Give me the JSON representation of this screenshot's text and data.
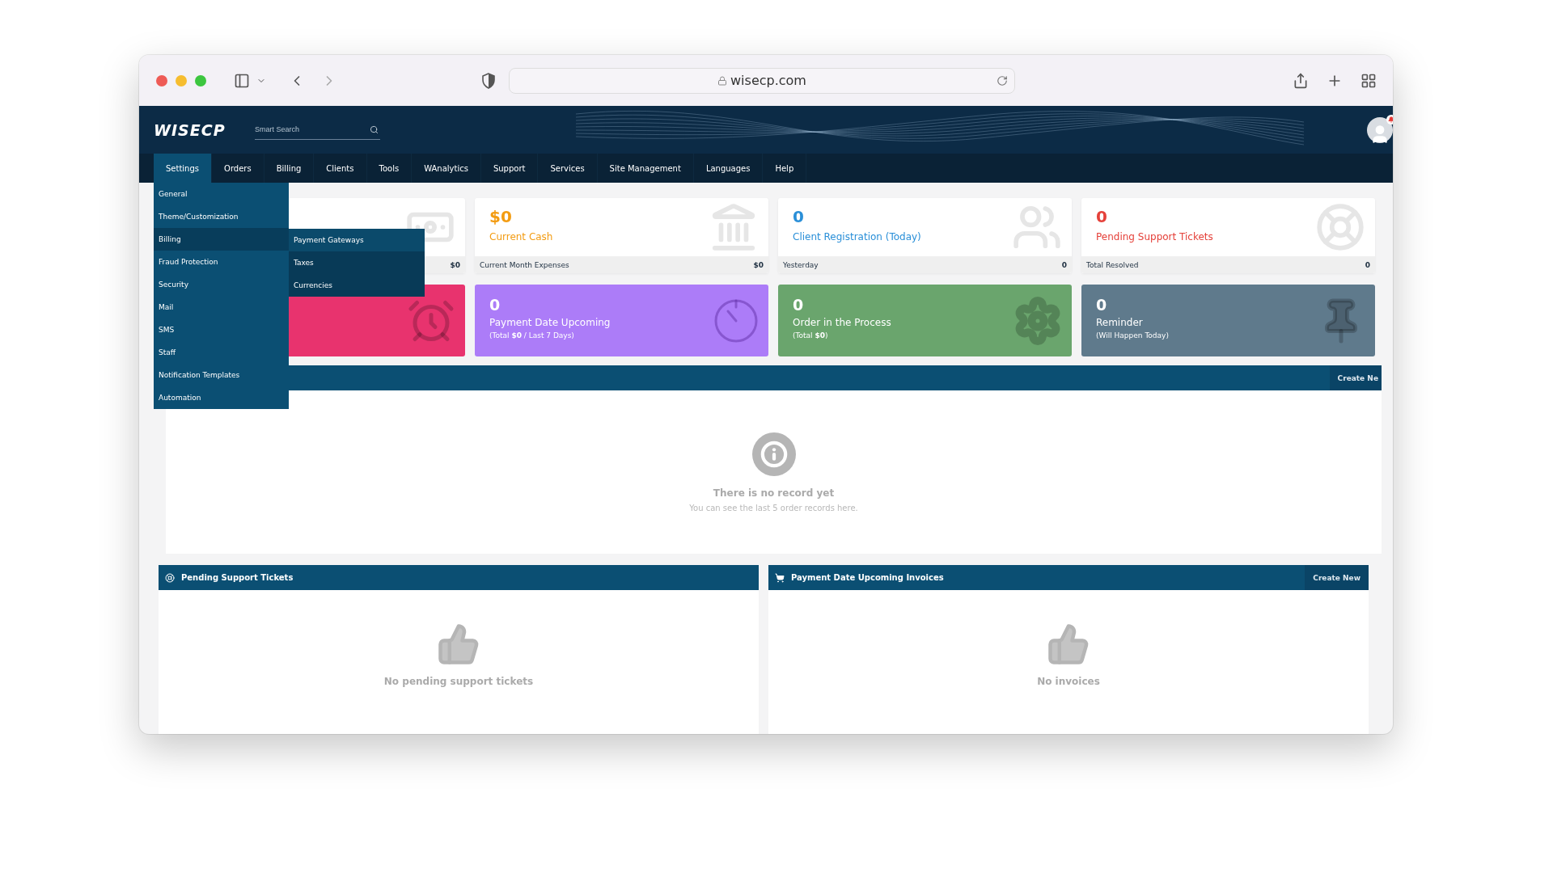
{
  "browser": {
    "url": "wisecp.com"
  },
  "header": {
    "logo": "WISECP",
    "search": {
      "placeholder": "Smart Search"
    },
    "notification": true
  },
  "nav": [
    {
      "label": "Settings",
      "selected": true
    },
    {
      "label": "Orders",
      "selected": false
    },
    {
      "label": "Billing",
      "selected": false
    },
    {
      "label": "Clients",
      "selected": false
    },
    {
      "label": "Tools",
      "selected": false
    },
    {
      "label": "WAnalytics",
      "selected": false
    },
    {
      "label": "Support",
      "selected": false
    },
    {
      "label": "Services",
      "selected": false
    },
    {
      "label": "Site Management",
      "selected": false
    },
    {
      "label": "Languages",
      "selected": false
    },
    {
      "label": "Help",
      "selected": false
    }
  ],
  "settings_menu": [
    {
      "label": "General",
      "selected": false
    },
    {
      "label": "Theme/Customization",
      "selected": false
    },
    {
      "label": "Billing",
      "selected": true
    },
    {
      "label": "Fraud Protection",
      "selected": false
    },
    {
      "label": "Security",
      "selected": false
    },
    {
      "label": "Mail",
      "selected": false
    },
    {
      "label": "SMS",
      "selected": false
    },
    {
      "label": "Staff",
      "selected": false
    },
    {
      "label": "Notification Templates",
      "selected": false
    },
    {
      "label": "Automation",
      "selected": false
    }
  ],
  "billing_submenu": [
    {
      "label": "Payment Gateways",
      "selected": true
    },
    {
      "label": "Taxes",
      "selected": false
    },
    {
      "label": "Currencies",
      "selected": false
    }
  ],
  "stat_cards": [
    {
      "kind": "money",
      "footer_value": "$0"
    },
    {
      "kind": "bank",
      "value": "$0",
      "label": "Current Cash",
      "footer_label": "Current Month Expenses",
      "footer_value": "$0",
      "color": "#f39c12"
    },
    {
      "kind": "users",
      "value": "0",
      "label": "Client Registration (Today)",
      "footer_label": "Yesterday",
      "footer_value": "0",
      "color": "#2a8fd8"
    },
    {
      "kind": "lifebuoy",
      "value": "0",
      "label": "Pending Support Tickets",
      "footer_label": "Total Resolved",
      "footer_value": "0",
      "color": "#e5413a"
    }
  ],
  "status_cards": [
    {
      "kind": "alarm",
      "color": "#e8336e"
    },
    {
      "kind": "timer",
      "value": "0",
      "label": "Payment Date Upcoming",
      "note": "(Total **$0** / Last 7 Days)",
      "color": "#ac7cf8"
    },
    {
      "kind": "gear",
      "value": "0",
      "label": "Order in the Process",
      "note": "(Total **$0**)",
      "color": "#6aa56d"
    },
    {
      "kind": "pin",
      "value": "0",
      "label": "Reminder",
      "note": "(Will Happen Today)",
      "color": "#5f7a8c"
    }
  ],
  "orders_panel": {
    "action": "Create Ne",
    "empty_title": "There is no record yet",
    "empty_text": "You can see the last 5 order records here."
  },
  "panels": [
    {
      "kind": "tickets",
      "title": "Pending Support Tickets",
      "empty_text": "No pending support tickets"
    },
    {
      "kind": "invoices",
      "title": "Payment Date Upcoming Invoices",
      "action": "Create New",
      "empty_text": "No invoices"
    }
  ]
}
